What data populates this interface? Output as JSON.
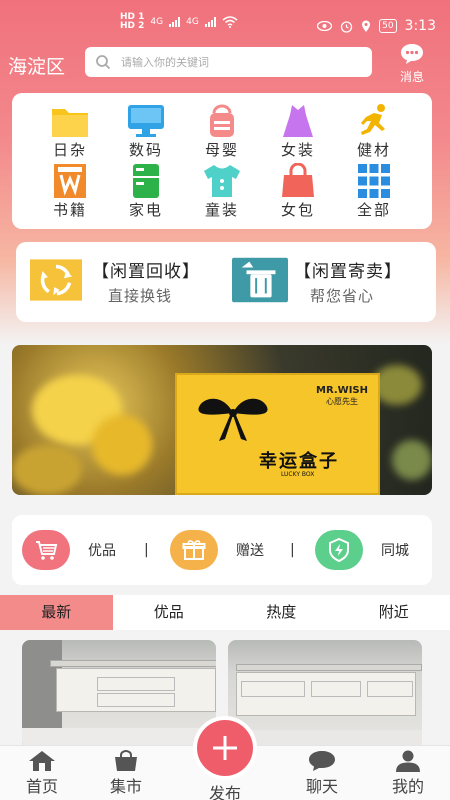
{
  "status_bar": {
    "network_left": "HD 1",
    "network_left2": "HD 2",
    "network_type1": "4G",
    "network_type2": "4G",
    "battery": "50",
    "time": "3:13"
  },
  "header": {
    "location": "海淀区",
    "search_placeholder": "请输入你的关键词",
    "message_label": "消息"
  },
  "categories": [
    {
      "label": "日杂",
      "icon": "folder-icon",
      "color": "#f7c51e"
    },
    {
      "label": "数码",
      "icon": "monitor-icon",
      "color": "#2fa3e6"
    },
    {
      "label": "母婴",
      "icon": "baby-bag-icon",
      "color": "#f58a8a"
    },
    {
      "label": "女装",
      "icon": "dress-icon",
      "color": "#c774ef"
    },
    {
      "label": "健材",
      "icon": "running-icon",
      "color": "#f3b400"
    },
    {
      "label": "书籍",
      "icon": "book-icon",
      "color": "#f08a2a"
    },
    {
      "label": "家电",
      "icon": "fridge-icon",
      "color": "#2db24a"
    },
    {
      "label": "童装",
      "icon": "kids-shirt-icon",
      "color": "#4fd0c8"
    },
    {
      "label": "女包",
      "icon": "handbag-icon",
      "color": "#f0645a"
    },
    {
      "label": "全部",
      "icon": "grid-icon",
      "color": "#2a8de0"
    }
  ],
  "trade": {
    "recycle_title": "【闲置回收】",
    "recycle_sub": "直接换钱",
    "sell_title": "【闲置寄卖】",
    "sell_sub": "帮您省心"
  },
  "banner": {
    "brand_line1": "MR.WISH",
    "brand_line2": "心愿先生",
    "title": "幸运盒子",
    "subtitle": "LUCKY BOX"
  },
  "services": [
    {
      "label": "优品",
      "icon": "cart-icon",
      "color": "#f0737d"
    },
    {
      "label": "赠送",
      "icon": "gift-icon",
      "color": "#f6b24a"
    },
    {
      "label": "同城",
      "icon": "lightning-shield-icon",
      "color": "#5ccf8d"
    }
  ],
  "service_separator": "|",
  "tabs": [
    {
      "label": "最新",
      "active": true
    },
    {
      "label": "优品",
      "active": false
    },
    {
      "label": "热度",
      "active": false
    },
    {
      "label": "附近",
      "active": false
    }
  ],
  "bottom_nav": [
    {
      "label": "首页",
      "icon": "home-icon"
    },
    {
      "label": "集市",
      "icon": "shopping-bag-icon"
    },
    {
      "label": "发布",
      "icon": "plus-icon"
    },
    {
      "label": "聊天",
      "icon": "chat-icon"
    },
    {
      "label": "我的",
      "icon": "user-icon"
    }
  ],
  "colors": {
    "accent": "#ef5d6a",
    "header_gradient_top": "#f0717c",
    "active_tab": "#f48b8b"
  }
}
